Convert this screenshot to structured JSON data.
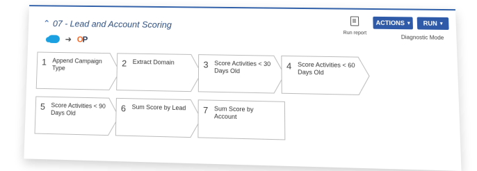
{
  "header": {
    "title": "07 - Lead and Account Scoring",
    "run_report_label": "Run report",
    "actions_label": "ACTIONS",
    "run_label": "RUN",
    "mode_label": "Diagnostic Mode",
    "logo_text_o": "O",
    "logo_text_p": "P"
  },
  "steps": [
    {
      "number": "1",
      "label": "Append Campaign Type"
    },
    {
      "number": "2",
      "label": "Extract Domain"
    },
    {
      "number": "3",
      "label": "Score Activities < 30 Days Old"
    },
    {
      "number": "4",
      "label": "Score Activities < 60 Days Old"
    },
    {
      "number": "5",
      "label": "Score Activities < 90 Days Old"
    },
    {
      "number": "6",
      "label": "Sum Score by Lead"
    },
    {
      "number": "7",
      "label": "Sum Score by Account"
    }
  ],
  "colors": {
    "accent": "#2e5aa8",
    "salesforce": "#1ba1e2",
    "op_orange": "#f26b2b"
  },
  "icons": [
    "chevron-up-icon",
    "salesforce-icon",
    "arrow-right-icon",
    "op-logo",
    "document-icon",
    "caret-down-icon"
  ]
}
